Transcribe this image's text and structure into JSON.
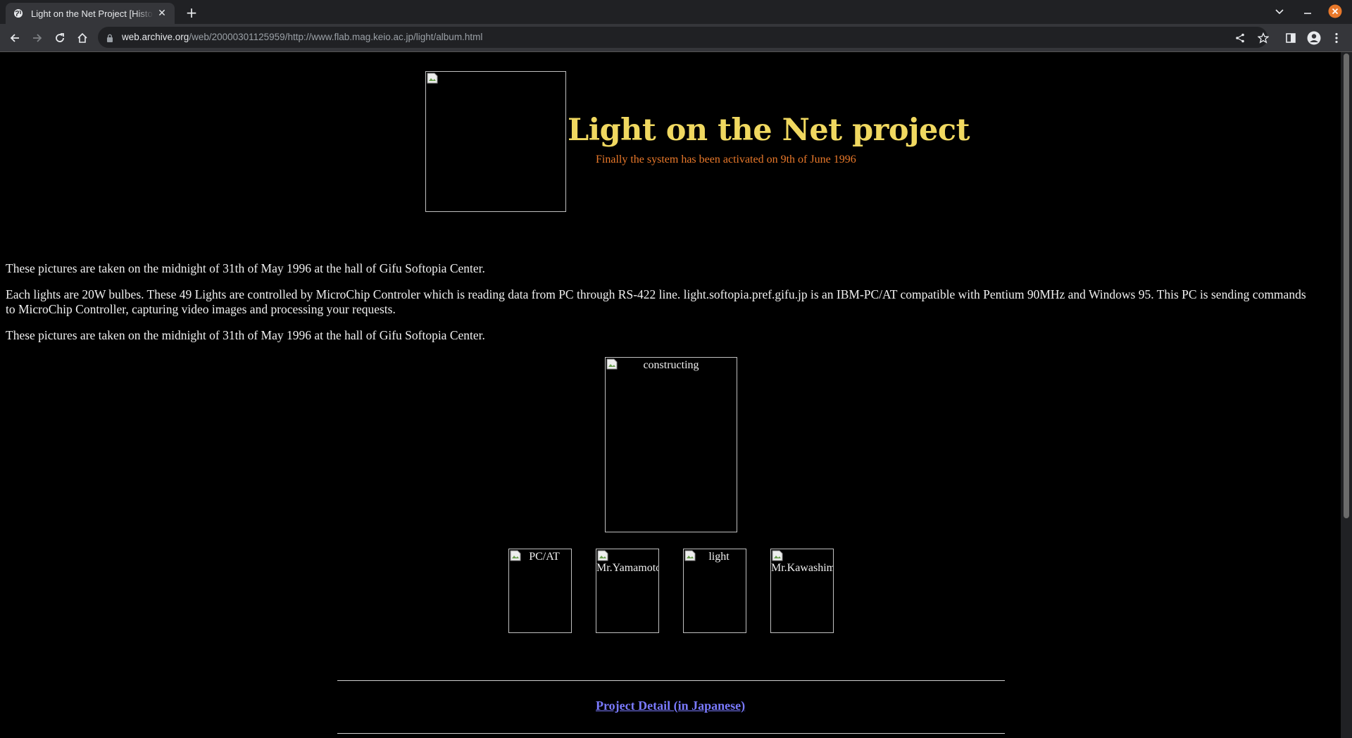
{
  "browser": {
    "tab_title": "Light on the Net Project [History]",
    "url_host": "web.archive.org",
    "url_path": "/web/20000301125959/http://www.flab.mag.keio.ac.jp/light/album.html",
    "accent_close": "#e8782a"
  },
  "page": {
    "heading": "Light on the Net project",
    "subheading": "Finally the system has been activated on 9th of June 1996",
    "para1": "These pictures are taken on the midnight of 31th of May 1996 at the hall of Gifu Softopia Center.",
    "para2": "Each lights are 20W bulbes. These 49 Lights are controlled by MicroChip Controler which is reading data from PC through RS-422 line. light.softopia.pref.gifu.jp is an IBM-PC/AT compatible with Pentium 90MHz and Windows 95. This PC is sending commands to MicroChip Controller, capturing video images and processing your requests.",
    "para3": "These pictures are taken on the midnight of 31th of May 1996 at the hall of Gifu Softopia Center.",
    "images": {
      "main_alt": "constructing",
      "thumb1_alt": "PC/AT",
      "thumb2_alt": "Mr.Yamamoto",
      "thumb3_alt": "light",
      "thumb4_alt": "Mr.Kawashima"
    },
    "detail_link": "Project Detail (in Japanese)",
    "colors": {
      "heading": "#f0d860",
      "subheading": "#e8782a",
      "link": "#7a7aff",
      "background": "#000000"
    }
  }
}
